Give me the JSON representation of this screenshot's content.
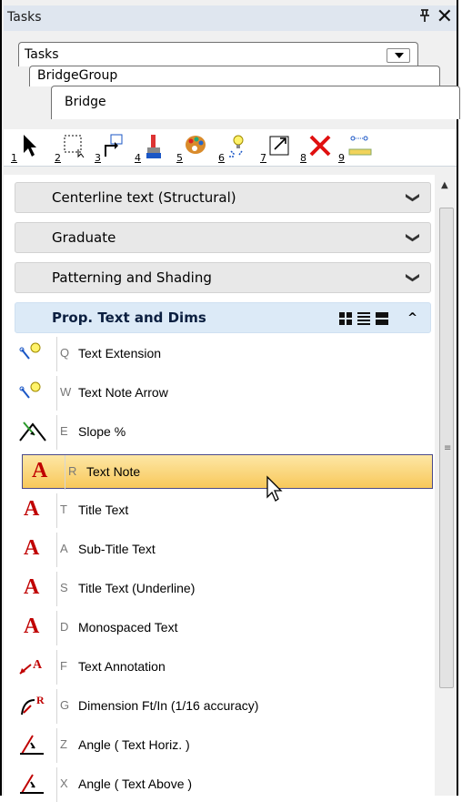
{
  "title": "Tasks",
  "title_buttons": {
    "pin": "ᵽ",
    "close": "✕"
  },
  "tabs": {
    "level1": "Tasks",
    "level2": "BridgeGroup",
    "level3": "Bridge"
  },
  "toolbar": {
    "tools": [
      {
        "num": "1",
        "icon": "select-arrow-icon"
      },
      {
        "num": "2",
        "icon": "select-box-icon"
      },
      {
        "num": "3",
        "icon": "move-icon"
      },
      {
        "num": "4",
        "icon": "paint-brush-icon"
      },
      {
        "num": "5",
        "icon": "palette-icon"
      },
      {
        "num": "6",
        "icon": "lightbulb-sparkle-icon"
      },
      {
        "num": "7",
        "icon": "resize-box-icon"
      },
      {
        "num": "8",
        "icon": "delete-x-icon"
      },
      {
        "num": "9",
        "icon": "measure-icon"
      }
    ]
  },
  "sections": [
    {
      "label": "Centerline text (Structural)",
      "state": "collapsed"
    },
    {
      "label": "Graduate",
      "state": "collapsed"
    },
    {
      "label": "Patterning and Shading",
      "state": "collapsed"
    },
    {
      "label": "Prop. Text and Dims",
      "state": "expanded"
    }
  ],
  "items": [
    {
      "key": "Q",
      "label": "Text Extension",
      "icon": "text-extension-icon"
    },
    {
      "key": "W",
      "label": "Text Note Arrow",
      "icon": "text-note-arrow-icon"
    },
    {
      "key": "E",
      "label": "Slope %",
      "icon": "slope-icon"
    },
    {
      "key": "R",
      "label": "Text Note",
      "icon": "text-A-icon",
      "selected": true
    },
    {
      "key": "T",
      "label": "Title Text",
      "icon": "text-A-icon"
    },
    {
      "key": "A",
      "label": "Sub-Title Text",
      "icon": "text-A-icon"
    },
    {
      "key": "S",
      "label": "Title Text (Underline)",
      "icon": "text-A-icon"
    },
    {
      "key": "D",
      "label": "Monospaced Text",
      "icon": "text-A-icon"
    },
    {
      "key": "F",
      "label": "Text Annotation",
      "icon": "text-annotation-icon"
    },
    {
      "key": "G",
      "label": "Dimension Ft/In (1/16 accuracy)",
      "icon": "dimension-icon"
    },
    {
      "key": "Z",
      "label": "Angle ( Text Horiz. )",
      "icon": "angle-icon"
    },
    {
      "key": "X",
      "label": "Angle ( Text Above )",
      "icon": "angle-icon"
    }
  ],
  "colors": {
    "selected_row": "#f8c85b",
    "accent": "#c00000",
    "active_header": "#dceaf7"
  }
}
